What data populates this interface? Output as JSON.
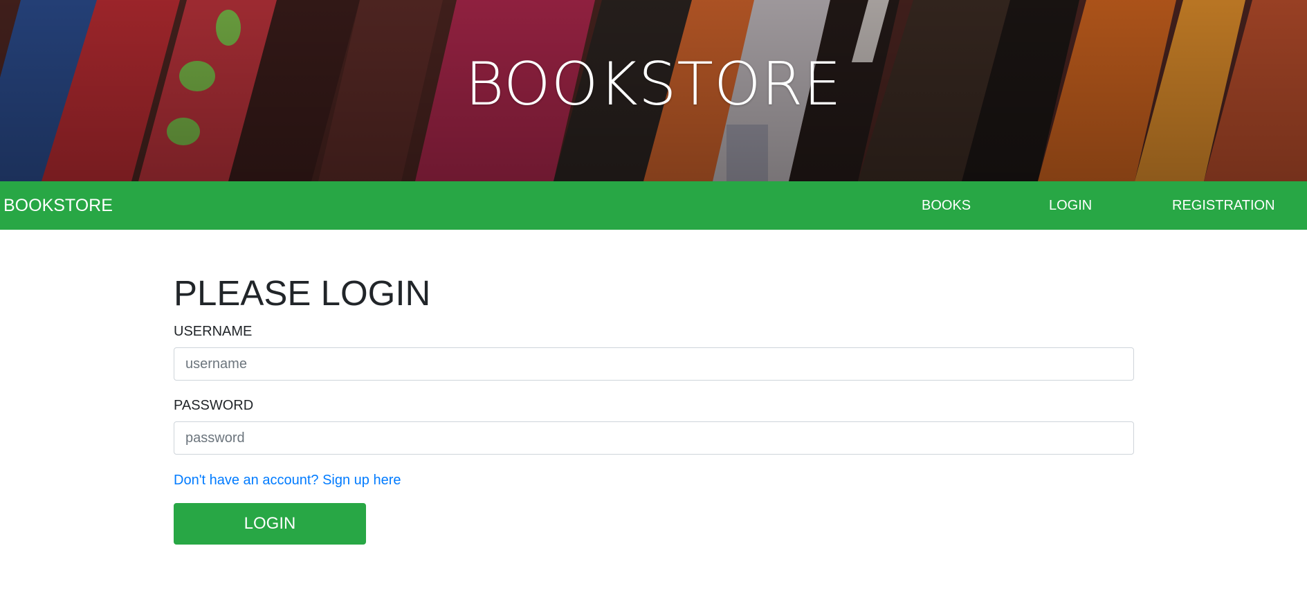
{
  "hero": {
    "title": "BOOKSTORE"
  },
  "navbar": {
    "brand": "BOOKSTORE",
    "links": [
      {
        "label": "BOOKS"
      },
      {
        "label": "LOGIN"
      },
      {
        "label": "REGISTRATION"
      }
    ],
    "background_color": "#28a745"
  },
  "login_form": {
    "title": "PLEASE LOGIN",
    "username_label": "USERNAME",
    "username_placeholder": "username",
    "password_label": "PASSWORD",
    "password_placeholder": "password",
    "signup_link": "Don't have an account? Sign up here",
    "submit_label": "LOGIN"
  },
  "colors": {
    "accent_green": "#28a745",
    "link_blue": "#007bff",
    "text_dark": "#212529"
  }
}
